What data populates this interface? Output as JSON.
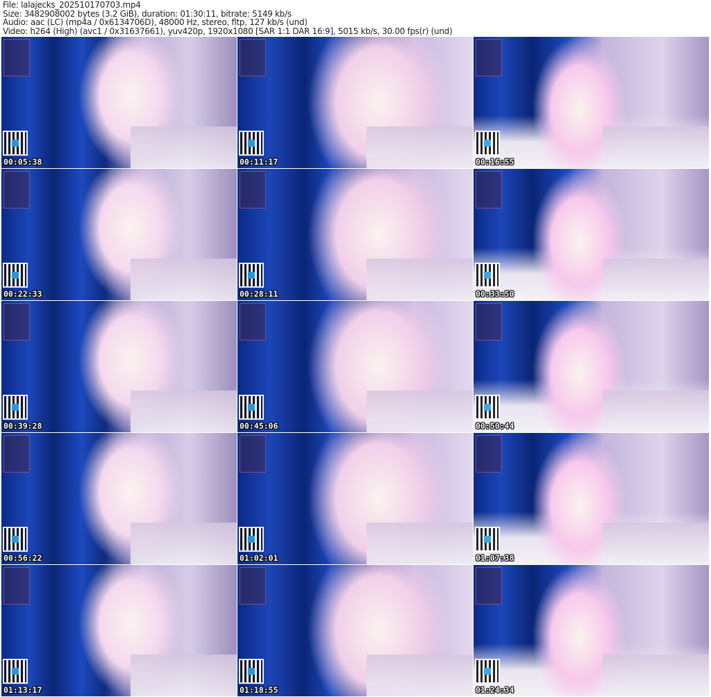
{
  "header": {
    "file": "File: lalajecks_202510170703.mp4",
    "size": "Size: 3482908002 bytes (3.2 GiB), duration: 01:30:11, bitrate: 5149 kb/s",
    "audio": "Audio: aac (LC) (mp4a / 0x6134706D), 48000 Hz, stereo, fltp, 127 kb/s (und)",
    "video": "Video: h264 (High) (avc1 / 0x31637661), yuv420p, 1920x1080 [SAR 1:1 DAR 16:9], 5015 kb/s, 30.00 fps(r) (und)"
  },
  "thumbnails": [
    {
      "timestamp": "00:05:38"
    },
    {
      "timestamp": "00:11:17"
    },
    {
      "timestamp": "00:16:55"
    },
    {
      "timestamp": "00:22:33"
    },
    {
      "timestamp": "00:28:11"
    },
    {
      "timestamp": "00:33:50"
    },
    {
      "timestamp": "00:39:28"
    },
    {
      "timestamp": "00:45:06"
    },
    {
      "timestamp": "00:50:44"
    },
    {
      "timestamp": "00:56:22"
    },
    {
      "timestamp": "01:02:01"
    },
    {
      "timestamp": "01:07:38"
    },
    {
      "timestamp": "01:13:17"
    },
    {
      "timestamp": "01:18:55"
    },
    {
      "timestamp": "01:24:34"
    }
  ]
}
